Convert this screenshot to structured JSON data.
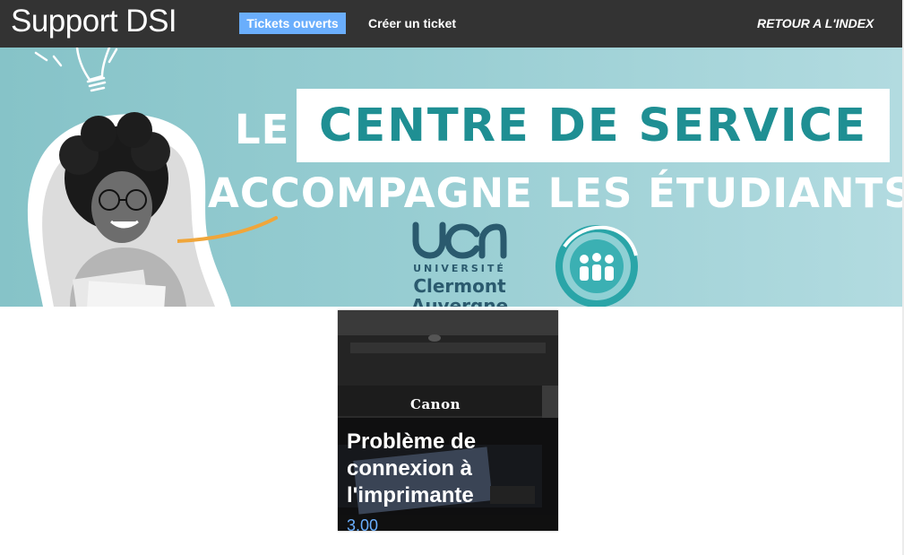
{
  "nav": {
    "brand": "Support DSI",
    "open_tickets": "Tickets ouverts",
    "create_ticket": "Créer un ticket",
    "back_to_index": "RETOUR A L'INDEX"
  },
  "banner": {
    "headline_le": "LE",
    "headline_box": "CENTRE DE SERVICE",
    "headline_sub": "ACCOMPAGNE LES ÉTUDIANTS",
    "university_label": "UNIVERSITÉ",
    "university_name_1": "Clermont",
    "university_name_2": "Auvergne",
    "uca_mark": "uca",
    "printer_brand": "Canon"
  },
  "cards": [
    {
      "title": "Problème de connexion à l'imprimante",
      "price": "3.00",
      "icon": "printer-image"
    }
  ],
  "colors": {
    "nav_bg": "#333333",
    "nav_active": "#6aaefc",
    "banner_teal": "#1f8f93",
    "price_blue": "#6aaefc"
  }
}
